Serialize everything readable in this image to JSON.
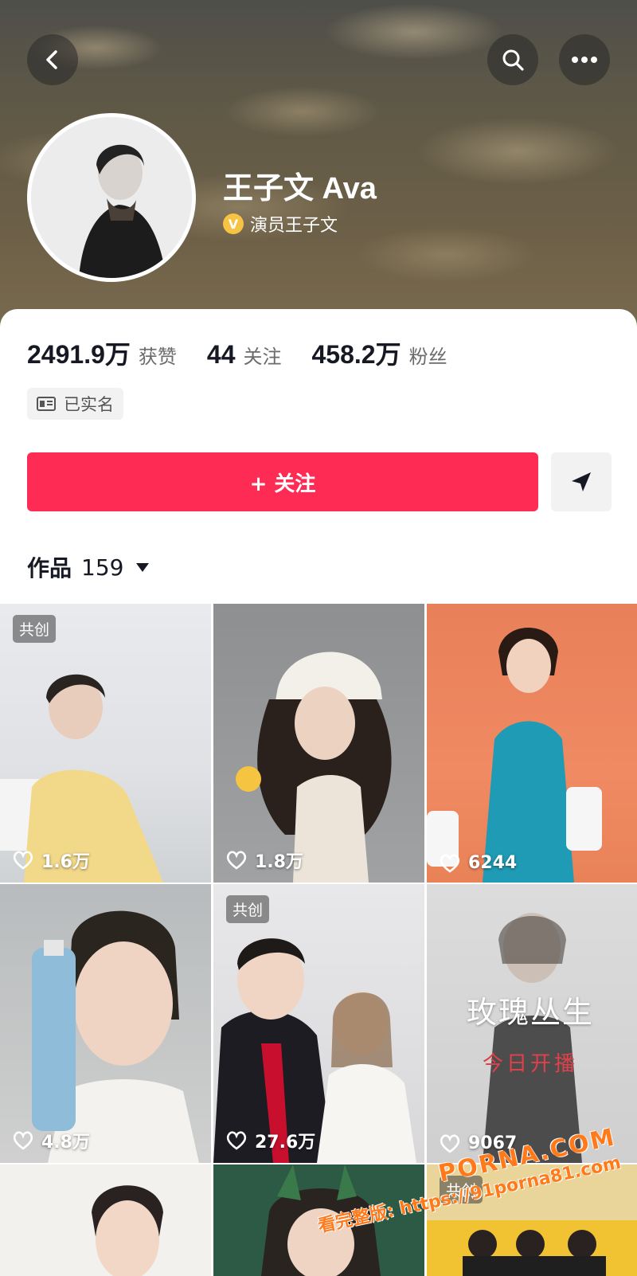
{
  "profile": {
    "name": "王子文 Ava",
    "verified_title": "演员王子文",
    "badge_letter": "V"
  },
  "stats": [
    {
      "value": "2491.9万",
      "label": "获赞"
    },
    {
      "value": "44",
      "label": "关注"
    },
    {
      "value": "458.2万",
      "label": "粉丝"
    }
  ],
  "realname_label": "已实名",
  "actions": {
    "follow_label": "+ 关注"
  },
  "works": {
    "label": "作品",
    "count": "159"
  },
  "videos": [
    {
      "likes": "1.6万",
      "tag": "共创"
    },
    {
      "likes": "1.8万",
      "tag": ""
    },
    {
      "likes": "6244",
      "tag": ""
    },
    {
      "likes": "4.8万",
      "tag": ""
    },
    {
      "likes": "27.6万",
      "tag": "共创"
    },
    {
      "likes": "9067",
      "tag": ""
    },
    {
      "likes": "",
      "tag": ""
    },
    {
      "likes": "",
      "tag": ""
    },
    {
      "likes": "",
      "tag": "共创"
    }
  ],
  "thumb_text": {
    "drama_title": "玫瑰丛生",
    "drama_sub": "今日开播"
  },
  "watermark": {
    "line1": "PORNA.COM",
    "line2": "看完整版: https://91porna81.com"
  },
  "colors": {
    "accent": "#fe2c55",
    "badge": "#f6c343"
  }
}
